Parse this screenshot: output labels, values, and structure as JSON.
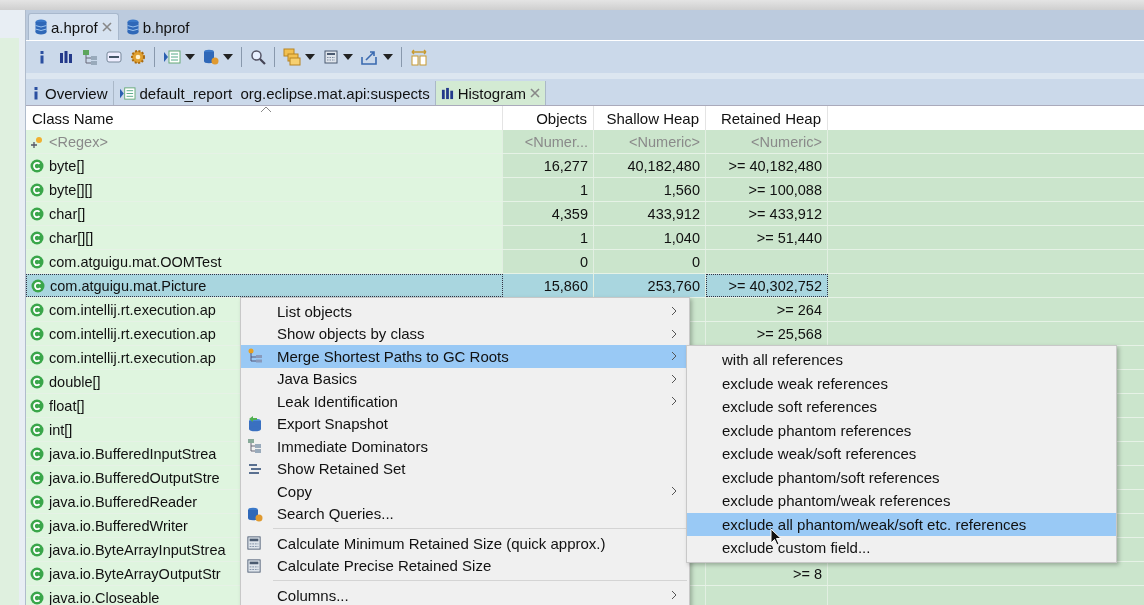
{
  "editor_tabs": [
    {
      "label": "a.hprof",
      "selected": true,
      "closable": true
    },
    {
      "label": "b.hprof",
      "selected": false,
      "closable": false
    }
  ],
  "view_tabs": [
    {
      "label": "Overview",
      "selected": false,
      "closable": false
    },
    {
      "label": "default_report  org.eclipse.mat.api:suspects",
      "selected": false,
      "closable": false
    },
    {
      "label": "Histogram",
      "selected": true,
      "closable": true
    }
  ],
  "table": {
    "columns": [
      "Class Name",
      "Objects",
      "Shallow Heap",
      "Retained Heap"
    ],
    "filter_row": [
      "<Regex>",
      "<Numer...",
      "<Numeric>",
      "<Numeric>"
    ],
    "rows": [
      {
        "name": "byte[]",
        "objects": "16,277",
        "shallow": "40,182,480",
        "retained": ">= 40,182,480",
        "selected": false
      },
      {
        "name": "byte[][]",
        "objects": "1",
        "shallow": "1,560",
        "retained": ">= 100,088",
        "selected": false
      },
      {
        "name": "char[]",
        "objects": "4,359",
        "shallow": "433,912",
        "retained": ">= 433,912",
        "selected": false
      },
      {
        "name": "char[][]",
        "objects": "1",
        "shallow": "1,040",
        "retained": ">= 51,440",
        "selected": false
      },
      {
        "name": "com.atguigu.mat.OOMTest",
        "objects": "0",
        "shallow": "0",
        "selected": false
      },
      {
        "name": "com.atguigu.mat.Picture",
        "objects": "15,860",
        "shallow": "253,760",
        "retained": ">= 40,302,752",
        "selected": true
      },
      {
        "name": "com.intellij.rt.execution.ap",
        "retained": ">= 264",
        "selected": false
      },
      {
        "name": "com.intellij.rt.execution.ap",
        "retained": ">= 25,568",
        "selected": false
      },
      {
        "name": "com.intellij.rt.execution.ap",
        "selected": false
      },
      {
        "name": "double[]",
        "selected": false
      },
      {
        "name": "float[]",
        "selected": false
      },
      {
        "name": "int[]",
        "selected": false
      },
      {
        "name": "java.io.BufferedInputStrea",
        "selected": false
      },
      {
        "name": "java.io.BufferedOutputStre",
        "selected": false
      },
      {
        "name": "java.io.BufferedReader",
        "selected": false
      },
      {
        "name": "java.io.BufferedWriter",
        "selected": false
      },
      {
        "name": "java.io.ByteArrayInputStrea",
        "selected": false
      },
      {
        "name": "java.io.ByteArrayOutputStr",
        "retained": ">= 8",
        "selected": false
      },
      {
        "name": "java.io.Closeable",
        "selected": false
      }
    ]
  },
  "context_menu": {
    "items": [
      {
        "kind": "item",
        "label": "List objects",
        "submenu": true,
        "selected": false
      },
      {
        "kind": "item",
        "label": "Show objects by class",
        "submenu": true,
        "selected": false
      },
      {
        "kind": "item",
        "label": "Merge Shortest Paths to GC Roots",
        "submenu": true,
        "selected": true
      },
      {
        "kind": "item",
        "label": "Java Basics",
        "submenu": true,
        "selected": false
      },
      {
        "kind": "item",
        "label": "Leak Identification",
        "submenu": true,
        "selected": false
      },
      {
        "kind": "item",
        "label": "Export Snapshot",
        "submenu": false,
        "selected": false
      },
      {
        "kind": "item",
        "label": "Immediate Dominators",
        "submenu": false,
        "selected": false
      },
      {
        "kind": "item",
        "label": "Show Retained Set",
        "submenu": false,
        "selected": false
      },
      {
        "kind": "item",
        "label": "Copy",
        "submenu": true,
        "selected": false
      },
      {
        "kind": "item",
        "label": "Search Queries...",
        "submenu": false,
        "selected": false
      },
      {
        "kind": "separator"
      },
      {
        "kind": "item",
        "label": "Calculate Minimum Retained Size (quick approx.)",
        "submenu": false,
        "selected": false
      },
      {
        "kind": "item",
        "label": "Calculate Precise Retained Size",
        "submenu": false,
        "selected": false
      },
      {
        "kind": "separator"
      },
      {
        "kind": "item",
        "label": "Columns...",
        "submenu": true,
        "selected": false
      }
    ]
  },
  "submenu": {
    "items": [
      {
        "label": "with all references",
        "selected": false
      },
      {
        "label": "exclude weak references",
        "selected": false
      },
      {
        "label": "exclude soft references",
        "selected": false
      },
      {
        "label": "exclude phantom references",
        "selected": false
      },
      {
        "label": "exclude weak/soft references",
        "selected": false
      },
      {
        "label": "exclude phantom/soft references",
        "selected": false
      },
      {
        "label": "exclude phantom/weak references",
        "selected": false
      },
      {
        "label": "exclude all phantom/weak/soft etc. references",
        "selected": true
      },
      {
        "label": "exclude custom field...",
        "selected": false
      }
    ]
  }
}
